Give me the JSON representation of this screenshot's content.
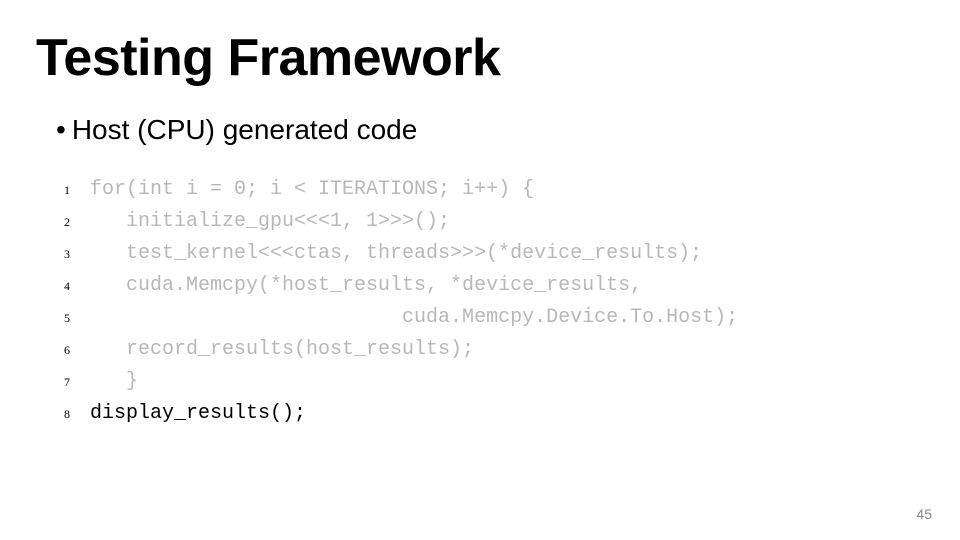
{
  "title": "Testing Framework",
  "bullet": "•",
  "bullet_text": "Host (CPU) generated code",
  "code_lines": [
    {
      "num": "1",
      "text": "for(int i = 0; i < ITERATIONS; i++) {",
      "emph": false
    },
    {
      "num": "2",
      "text": "   initialize_gpu<<<1, 1>>>();",
      "emph": false
    },
    {
      "num": "3",
      "text": "   test_kernel<<<ctas, threads>>>(*device_results);",
      "emph": false
    },
    {
      "num": "4",
      "text": "   cuda.Memcpy(*host_results, *device_results,",
      "emph": false
    },
    {
      "num": "5",
      "text": "                          cuda.Memcpy.Device.To.Host);",
      "emph": false
    },
    {
      "num": "6",
      "text": "   record_results(host_results);",
      "emph": false
    },
    {
      "num": "7",
      "text": "   }",
      "emph": false
    },
    {
      "num": "8",
      "text": "display_results();",
      "emph": true
    }
  ],
  "page_number": "45"
}
